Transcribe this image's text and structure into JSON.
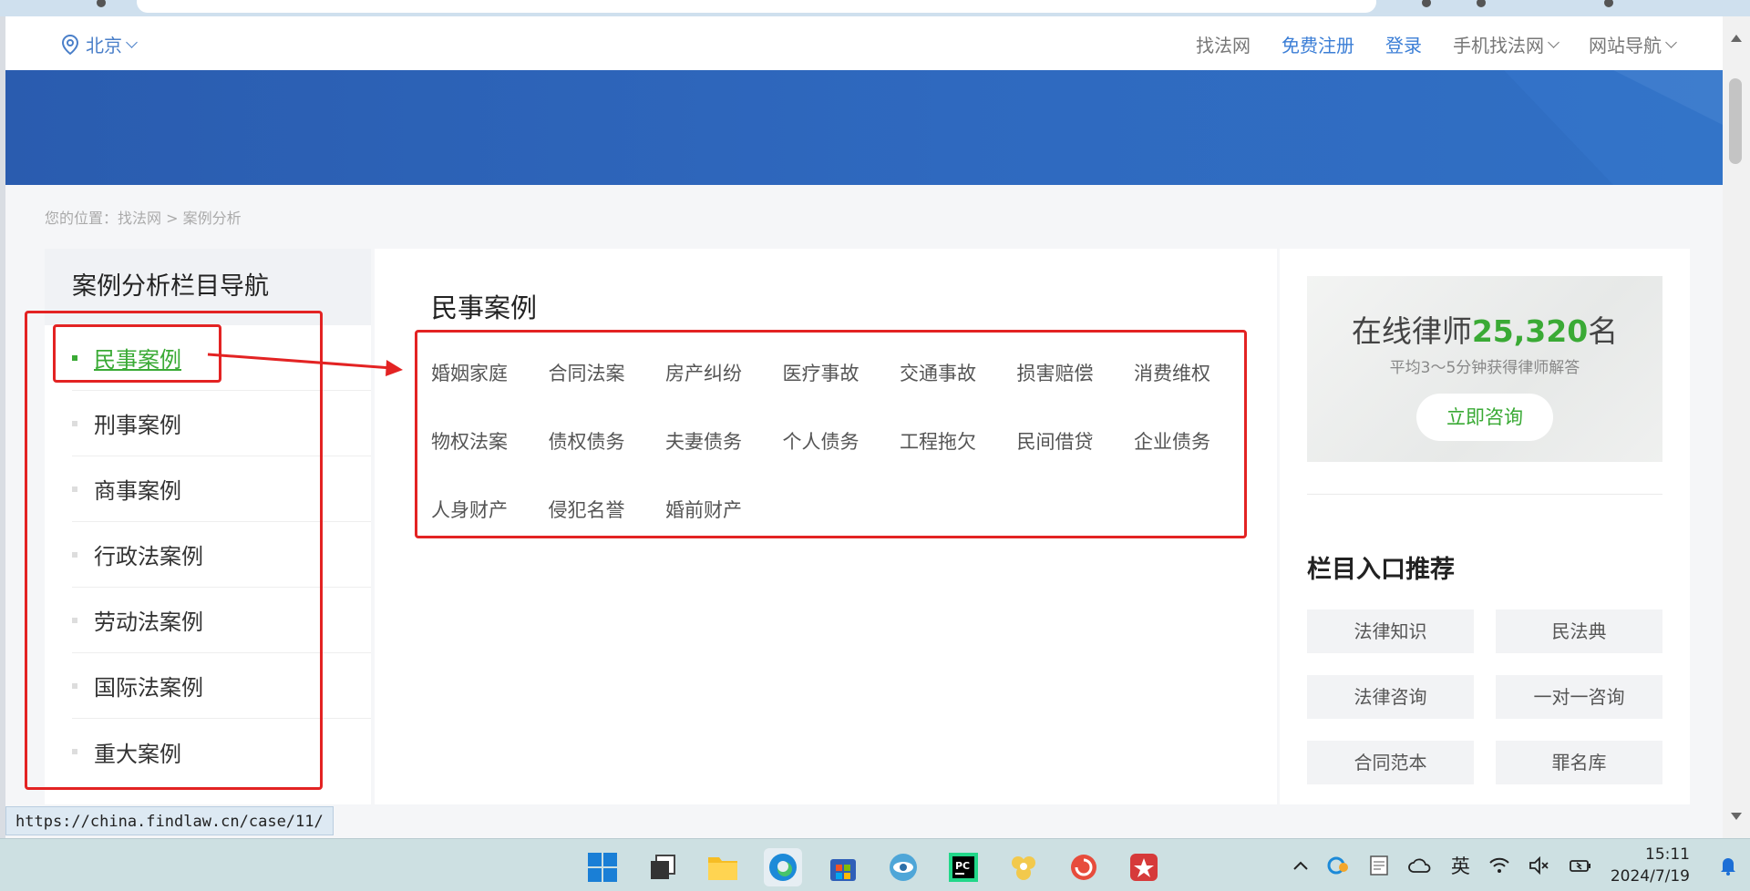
{
  "header": {
    "city": "北京",
    "nav": [
      {
        "label": "找法网",
        "style": "gray",
        "dropdown": false
      },
      {
        "label": "免费注册",
        "style": "blue",
        "dropdown": false
      },
      {
        "label": "登录",
        "style": "blue",
        "dropdown": false
      },
      {
        "label": "手机找法网",
        "style": "gray",
        "dropdown": true
      },
      {
        "label": "网站导航",
        "style": "gray",
        "dropdown": true
      }
    ]
  },
  "breadcrumb": "您的位置：找法网 > 案例分析",
  "left_nav": {
    "title": "案例分析栏目导航",
    "items": [
      "民事案例",
      "刑事案例",
      "商事案例",
      "行政法案例",
      "劳动法案例",
      "国际法案例",
      "重大案例"
    ],
    "active_index": 0
  },
  "main": {
    "title": "民事案例",
    "categories": [
      "婚姻家庭",
      "合同法案",
      "房产纠纷",
      "医疗事故",
      "交通事故",
      "损害赔偿",
      "消费维权",
      "物权法案",
      "债权债务",
      "夫妻债务",
      "个人债务",
      "工程拖欠",
      "民间借贷",
      "企业债务",
      "人身财产",
      "侵犯名誉",
      "婚前财产"
    ]
  },
  "right": {
    "lawyer_prefix": "在线律师",
    "lawyer_count": "25,320",
    "lawyer_suffix": "名",
    "lawyer_sub": "平均3～5分钟获得律师解答",
    "consult_button": "立即咨询",
    "section_title": "栏目入口推荐",
    "entries": [
      "法律知识",
      "民法典",
      "法律咨询",
      "一对一咨询",
      "合同范本",
      "罪名库"
    ]
  },
  "status_url": "https://china.findlaw.cn/case/11/",
  "tray": {
    "ime": "英",
    "time": "15:11",
    "date": "2024/7/19"
  },
  "colors": {
    "accent_green": "#3aaa35",
    "link_blue": "#3b7ed6",
    "banner_blue": "#2f69bf",
    "annotation_red": "#e32323"
  }
}
